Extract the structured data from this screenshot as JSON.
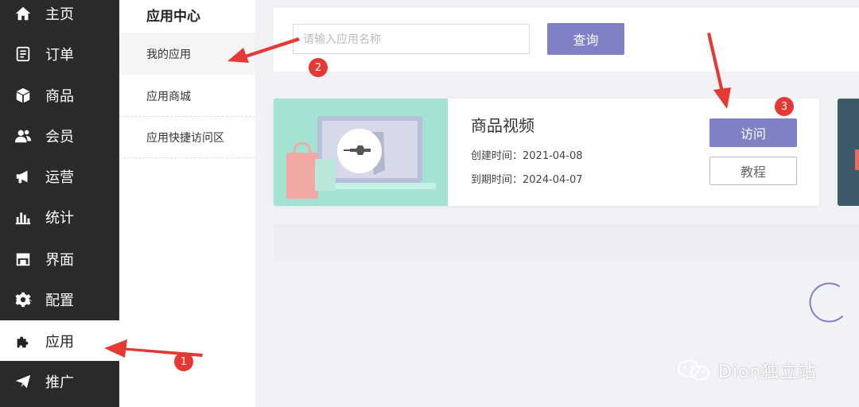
{
  "nav": {
    "items": [
      {
        "label": "主页",
        "icon": "home-icon"
      },
      {
        "label": "订单",
        "icon": "order-icon"
      },
      {
        "label": "商品",
        "icon": "box-icon"
      },
      {
        "label": "会员",
        "icon": "users-icon"
      },
      {
        "label": "运营",
        "icon": "megaphone-icon"
      },
      {
        "label": "统计",
        "icon": "bar-chart-icon"
      },
      {
        "label": "界面",
        "icon": "store-icon"
      },
      {
        "label": "配置",
        "icon": "gear-icon"
      },
      {
        "label": "应用",
        "icon": "puzzle-icon",
        "active": true
      },
      {
        "label": "推广",
        "icon": "paper-plane-icon"
      }
    ]
  },
  "subnav": {
    "title": "应用中心",
    "items": [
      {
        "label": "我的应用",
        "active": true
      },
      {
        "label": "应用商城"
      },
      {
        "label": "应用快捷访问区"
      }
    ]
  },
  "search": {
    "placeholder": "请输入应用名称",
    "button_label": "查询"
  },
  "app_card": {
    "title": "商品视频",
    "created_label": "创建时间：",
    "created_value": "2021-04-08",
    "expires_label": "到期时间：",
    "expires_value": "2024-04-07",
    "visit_label": "访问",
    "tutorial_label": "教程"
  },
  "markers": [
    "1",
    "2",
    "3"
  ],
  "watermark": "Dion独立站",
  "colors": {
    "accent": "#7f80c6",
    "sidebar": "#2a2a2a",
    "annotation": "#e53935",
    "card_image_bg": "#a4e2d4"
  }
}
